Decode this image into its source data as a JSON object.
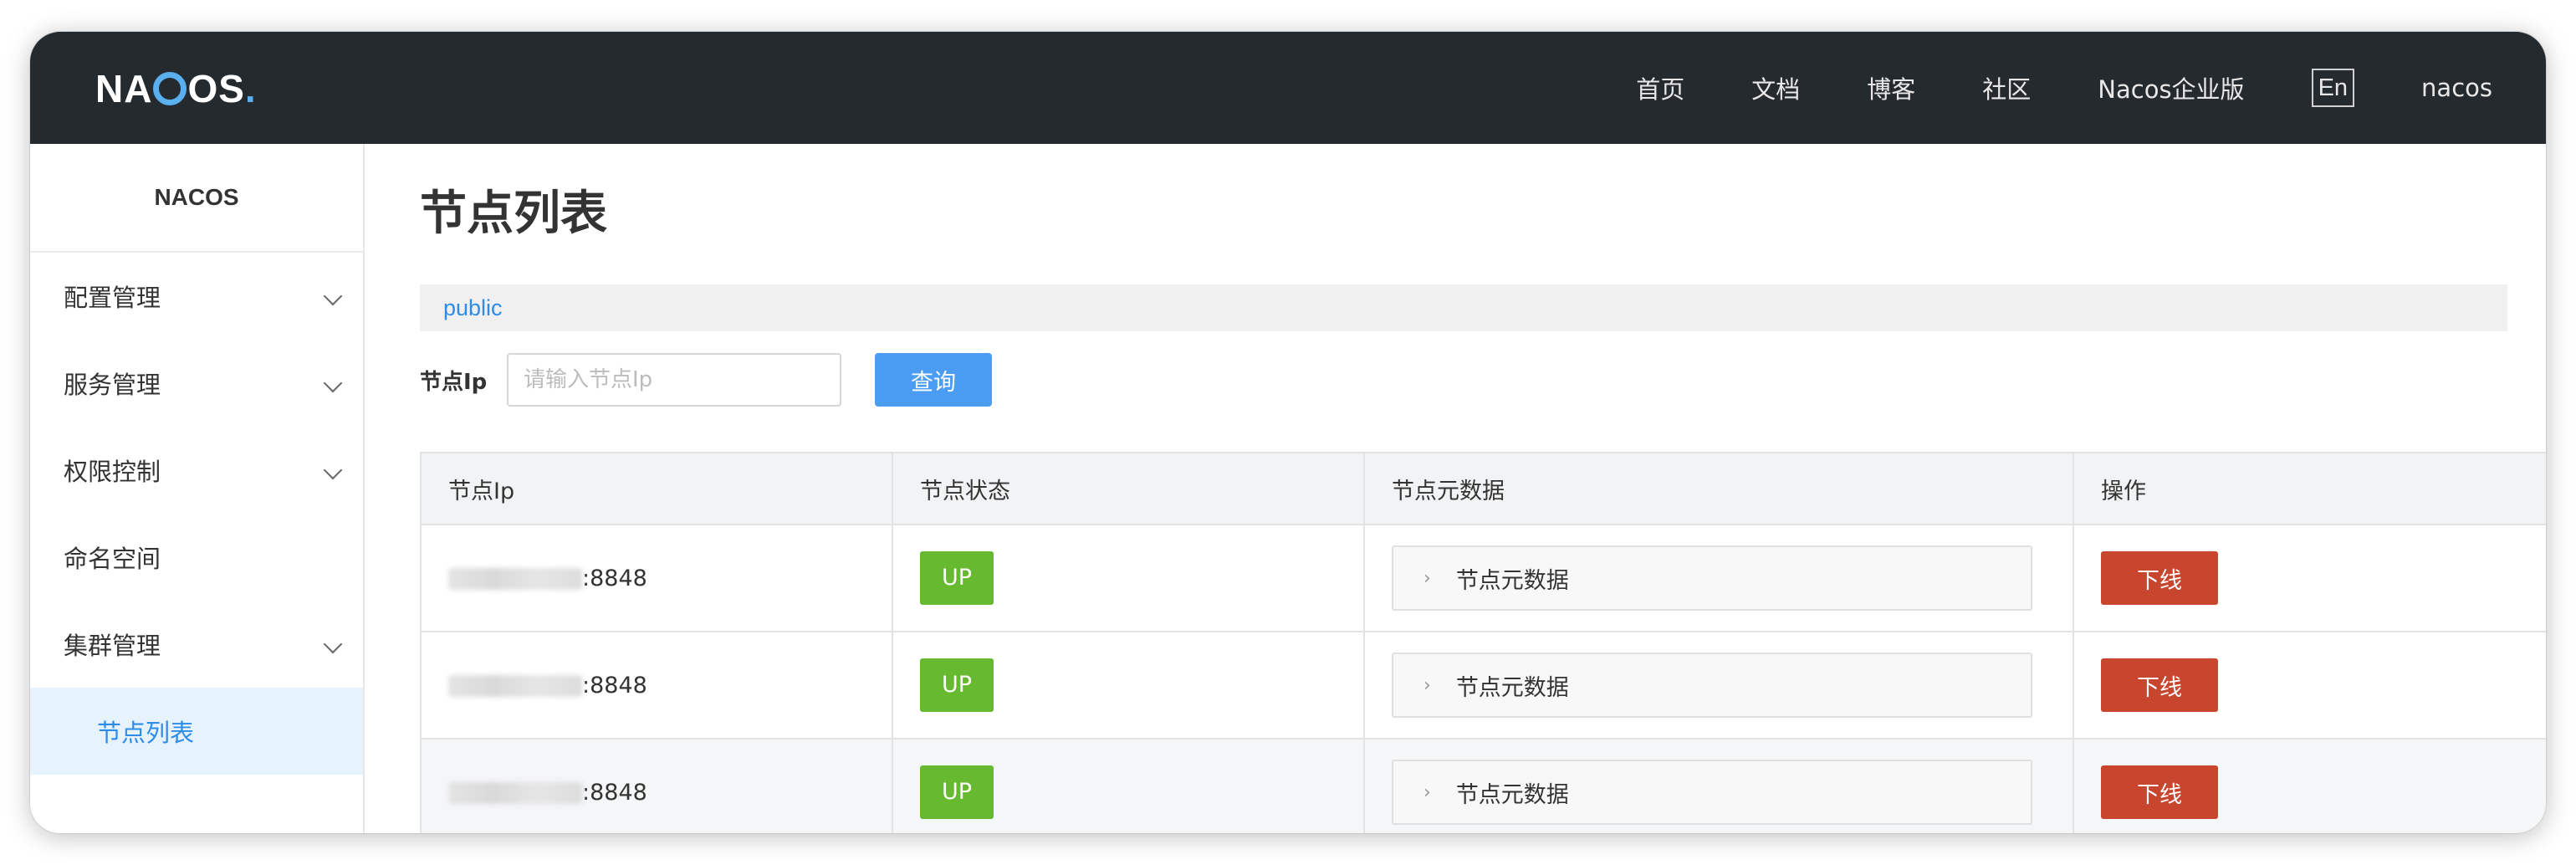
{
  "header": {
    "logo_text": "NACOS",
    "nav": [
      "首页",
      "文档",
      "博客",
      "社区",
      "Nacos企业版"
    ],
    "lang": "En",
    "user": "nacos"
  },
  "sidebar": {
    "title": "NACOS",
    "items": [
      {
        "label": "配置管理",
        "expandable": true
      },
      {
        "label": "服务管理",
        "expandable": true
      },
      {
        "label": "权限控制",
        "expandable": true
      },
      {
        "label": "命名空间",
        "expandable": false
      },
      {
        "label": "集群管理",
        "expandable": true
      },
      {
        "label": "节点列表",
        "active": true
      }
    ]
  },
  "main": {
    "title": "节点列表",
    "namespace": "public",
    "search": {
      "label": "节点Ip",
      "placeholder": "请输入节点Ip",
      "button": "查询"
    },
    "table": {
      "columns": [
        "节点Ip",
        "节点状态",
        "节点元数据",
        "操作"
      ],
      "rows": [
        {
          "ip": ":8848",
          "status": "UP",
          "meta": "节点元数据",
          "action": "下线"
        },
        {
          "ip": ":8848",
          "status": "UP",
          "meta": "节点元数据",
          "action": "下线"
        },
        {
          "ip": ":8848",
          "status": "UP",
          "meta": "节点元数据",
          "action": "下线"
        }
      ]
    }
  },
  "colors": {
    "header_bg": "#252a2f",
    "accent_blue": "#2d8ce8",
    "status_up": "#67b930",
    "offline_red": "#c8452e"
  }
}
